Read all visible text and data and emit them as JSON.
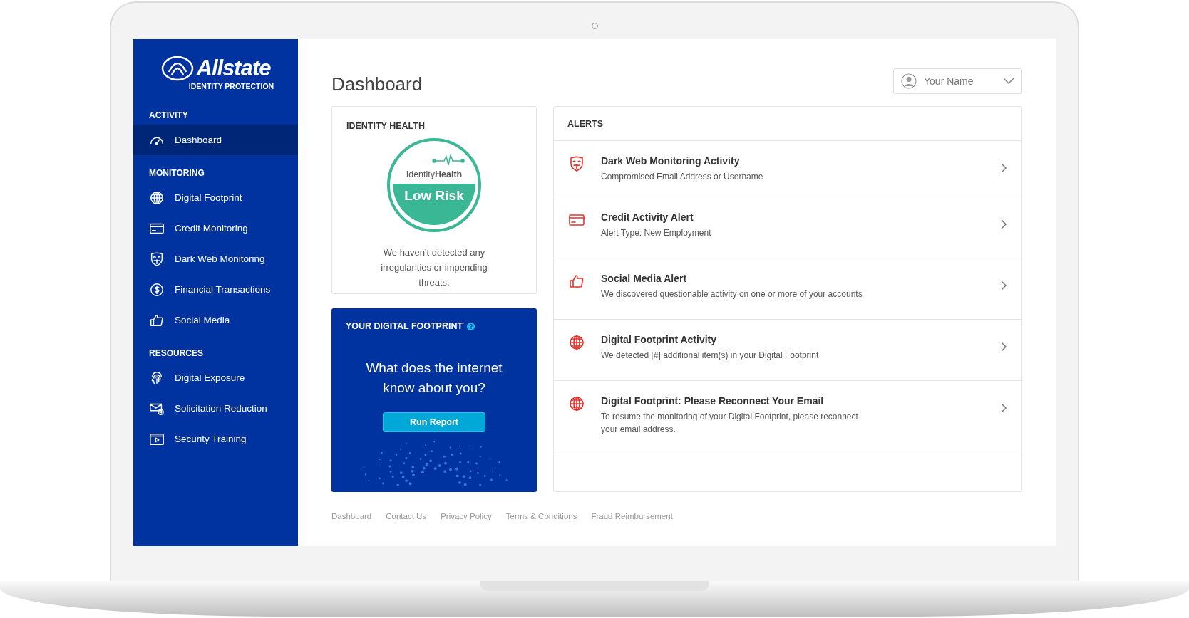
{
  "brand": {
    "name": "Allstate",
    "tagline": "IDENTITY PROTECTION"
  },
  "sidebar": {
    "sections": [
      {
        "heading": "ACTIVITY",
        "items": [
          {
            "label": "Dashboard",
            "selected": true
          }
        ]
      },
      {
        "heading": "MONITORING",
        "items": [
          {
            "label": "Digital Footprint",
            "selected": false
          },
          {
            "label": "Credit Monitoring",
            "selected": false
          },
          {
            "label": "Dark Web Monitoring",
            "selected": false
          },
          {
            "label": "Financial Transactions",
            "selected": false
          },
          {
            "label": "Social Media",
            "selected": false
          }
        ]
      },
      {
        "heading": "RESOURCES",
        "items": [
          {
            "label": "Digital Exposure",
            "selected": false
          },
          {
            "label": "Solicitation Reduction",
            "selected": false
          },
          {
            "label": "Security Training",
            "selected": false
          }
        ]
      }
    ]
  },
  "header": {
    "title": "Dashboard",
    "user": "Your Name"
  },
  "identity_health": {
    "title": "IDENTITY HEALTH",
    "badge_label": "Identity**Health**",
    "risk": "Low Risk",
    "message": "We haven't detected any irregularities or impending threats."
  },
  "digital_footprint": {
    "title": "YOUR DIGITAL FOOTPRINT",
    "question": "What does the internet know about you?",
    "button": "Run Report"
  },
  "alerts": {
    "title": "ALERTS",
    "items": [
      {
        "kind": "darkweb",
        "title": "Dark Web Monitoring Activity",
        "description": "Compromised Email Address or Username"
      },
      {
        "kind": "credit",
        "title": "Credit Activity Alert",
        "description": "Alert Type: New Employment"
      },
      {
        "kind": "social",
        "title": "Social Media Alert",
        "description": "We discovered questionable activity on one or more of your accounts"
      },
      {
        "kind": "globe",
        "title": "Digital Footprint Activity",
        "description": "We detected [#] additional item(s) in your Digital Footprint"
      },
      {
        "kind": "globe",
        "title": "Digital Footprint: Please Reconnect Your Email",
        "description": "To resume the monitoring of your Digital Footprint, please reconnect your email address."
      }
    ]
  },
  "footer": {
    "links": [
      "Dashboard",
      "Contact Us",
      "Privacy Policy",
      "Terms & Conditions",
      "Fraud Reimbursement"
    ]
  }
}
